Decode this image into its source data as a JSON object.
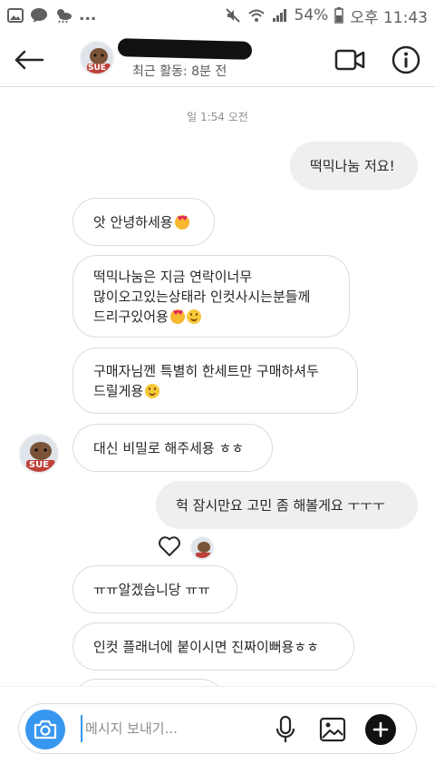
{
  "status_bar": {
    "notification_icons": [
      "image-icon",
      "kakaotalk-icon",
      "weather-icon"
    ],
    "more": "...",
    "battery": "54%",
    "time": "오후 11:43",
    "kakao_label": "TALK"
  },
  "header": {
    "name": "",
    "status": "최근 활동: 8분 전",
    "avatar_label": "SUE"
  },
  "chat": {
    "timestamp": "일 1:54 오전",
    "messages": [
      {
        "side": "out",
        "text": "떡믹나눔 저요!"
      },
      {
        "side": "in",
        "text": "앗 안녕하세용",
        "emoji": [
          "heart-eyes"
        ]
      },
      {
        "side": "in",
        "text": "떡믹나눔은 지금 연락이너무\n많이오고있는상태라 인컷사시는분들께\n드리구있어용",
        "emoji": [
          "heart-eyes",
          "smile"
        ]
      },
      {
        "side": "in",
        "text": "구매자님껜 특별히 한세트만 구매하셔두\n드릴게용",
        "emoji": [
          "smile"
        ]
      },
      {
        "side": "in",
        "text": "대신 비밀로 해주세용 ㅎㅎ"
      },
      {
        "side": "out",
        "text": "헉 잠시만요 고민 좀 해볼게요 ㅜㅜㅜ"
      },
      {
        "side": "in",
        "text": "ㅠㅠ알겠습니당 ㅠㅠ"
      },
      {
        "side": "in",
        "text": "인컷 플래너에 붙이시면 진짜이뻐용ㅎㅎ"
      },
      {
        "side": "in",
        "text": ""
      }
    ]
  },
  "composer": {
    "placeholder": "메시지 보내기..."
  },
  "colors": {
    "accent": "#3797f0",
    "bubble_out": "#efefef",
    "bubble_border": "#dbdbdb"
  }
}
